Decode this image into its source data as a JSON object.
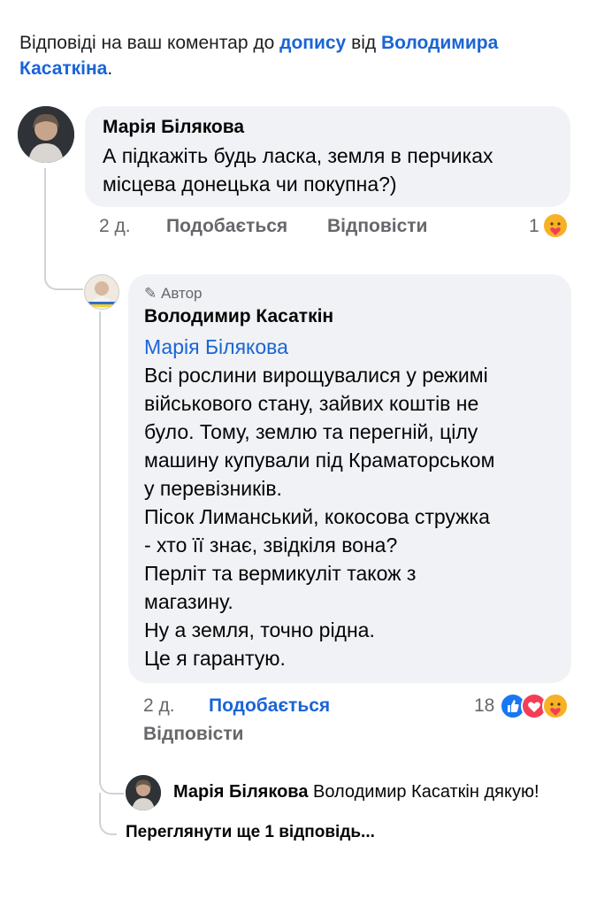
{
  "header": {
    "prefix": "Відповіді на ваш коментар до ",
    "post_link": "допису",
    "middle": " від ",
    "author_link": "Володимира Касаткіна",
    "suffix": "."
  },
  "comment1": {
    "author": "Марія Білякова",
    "text": "А підкажіть будь ласка, земля в перчиках місцева донецька чи покупна?)",
    "time": "2 д.",
    "like_label": "Подобається",
    "reply_label": "Відповісти",
    "reaction_count": "1"
  },
  "reply1": {
    "badge": "Автор",
    "author": "Володимир Касаткін",
    "mention": "Марія Білякова",
    "lines": [
      "Всі рослини вирощувалися у режимі",
      "військового стану, зайвих коштів не",
      "було. Тому, землю та перегній, цілу",
      "машину купували під Краматорськом",
      "у перевізників.",
      "Пісок Лиманський, кокосова стружка",
      "- хто її знає, звідкіля вона?",
      "Перліт та вермикуліт також з",
      "магазину.",
      "Ну а земля, точно рідна.",
      "Це я гарантую."
    ],
    "time": "2 д.",
    "like_label": "Подобається",
    "reply_label": "Відповісти",
    "reaction_count": "18"
  },
  "reply2": {
    "author": "Марія Білякова",
    "text": "Володимир Касаткін дякую!"
  },
  "more_replies": "Переглянути ще 1 відповідь...",
  "colors": {
    "link": "#1a64d6",
    "bubble": "#f0f2f5",
    "like": "#1877f2",
    "love": "#f33e58",
    "care": "#f7b125"
  },
  "icons": [
    "like-reaction-icon",
    "love-reaction-icon",
    "care-reaction-icon",
    "pencil-icon"
  ]
}
